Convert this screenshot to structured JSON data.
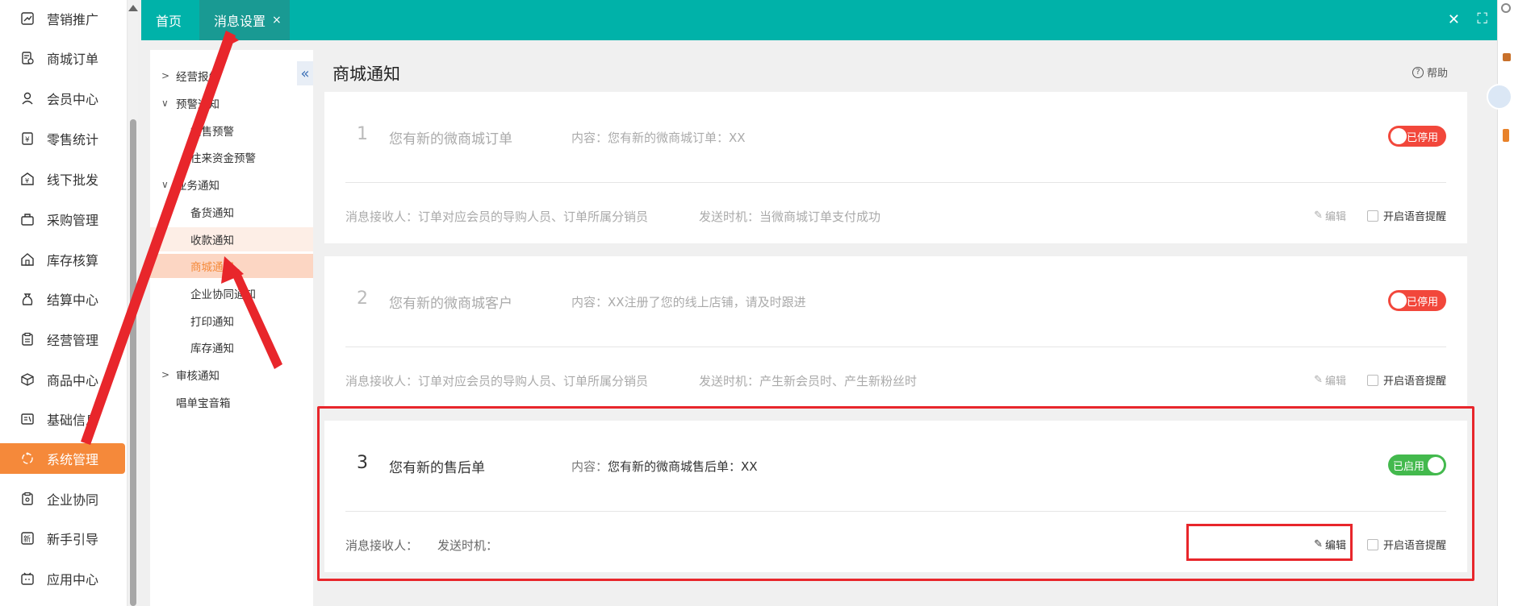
{
  "sidebar": {
    "items": [
      {
        "label": "营销推广",
        "icon": "megaphone-icon"
      },
      {
        "label": "商城订单",
        "icon": "order-icon"
      },
      {
        "label": "会员中心",
        "icon": "user-icon"
      },
      {
        "label": "零售统计",
        "icon": "stats-icon"
      },
      {
        "label": "线下批发",
        "icon": "wholesale-icon"
      },
      {
        "label": "采购管理",
        "icon": "purchase-icon"
      },
      {
        "label": "库存核算",
        "icon": "warehouse-icon"
      },
      {
        "label": "结算中心",
        "icon": "money-bag-icon"
      },
      {
        "label": "经营管理",
        "icon": "clipboard-icon"
      },
      {
        "label": "商品中心",
        "icon": "box-icon"
      },
      {
        "label": "基础信息",
        "icon": "info-card-icon"
      },
      {
        "label": "系统管理",
        "icon": "system-icon"
      },
      {
        "label": "企业协同",
        "icon": "collab-icon"
      },
      {
        "label": "新手引导",
        "icon": "guide-icon"
      },
      {
        "label": "应用中心",
        "icon": "app-icon"
      }
    ],
    "active_index": 11
  },
  "tabs": {
    "home": "首页",
    "message_settings": "消息设置",
    "close_glyph": "×"
  },
  "subnav": {
    "groups": [
      {
        "label": "经营报告",
        "expanded": false
      },
      {
        "label": "预警通知",
        "expanded": true,
        "children": [
          "销售预警",
          "往来资金预警"
        ]
      },
      {
        "label": "业务通知",
        "expanded": true,
        "children": [
          "备货通知",
          "收款通知",
          "商城通知",
          "企业协同通知",
          "打印通知",
          "库存通知"
        ]
      },
      {
        "label": "审核通知",
        "expanded": false
      }
    ],
    "extra": "唱单宝音箱",
    "selected": "商城通知",
    "hover": "收款通知"
  },
  "page": {
    "title": "商城通知",
    "help": "帮助"
  },
  "cards": [
    {
      "num": "1",
      "name": "您有新的微商城订单",
      "content_label": "内容：",
      "content": "您有新的微商城订单：XX",
      "status": "已停用",
      "receiver_label": "消息接收人：",
      "receiver": "订单对应会员的导购人员、订单所属分销员",
      "time_label": "发送时机：",
      "time": "当微商城订单支付成功",
      "edit": "编辑",
      "voice": "开启语音提醒"
    },
    {
      "num": "2",
      "name": "您有新的微商城客户",
      "content_label": "内容：",
      "content": "XX注册了您的线上店铺，请及时跟进",
      "status": "已停用",
      "receiver_label": "消息接收人：",
      "receiver": "订单对应会员的导购人员、订单所属分销员",
      "time_label": "发送时机：",
      "time": "产生新会员时、产生新粉丝时",
      "edit": "编辑",
      "voice": "开启语音提醒"
    },
    {
      "num": "3",
      "name": "您有新的售后单",
      "content_label": "内容：",
      "content": "您有新的微商城售后单：XX",
      "status": "已启用",
      "receiver_label": "消息接收人：",
      "receiver": "",
      "time_label": "发送时机：",
      "time": "",
      "edit": "编辑",
      "voice": "开启语音提醒"
    }
  ],
  "colors": {
    "topbar": "#00b2a9",
    "active_sidebar": "#f5893a",
    "toggle_off": "#f2473b",
    "toggle_on": "#43b94d",
    "annotation": "#e8262b"
  }
}
